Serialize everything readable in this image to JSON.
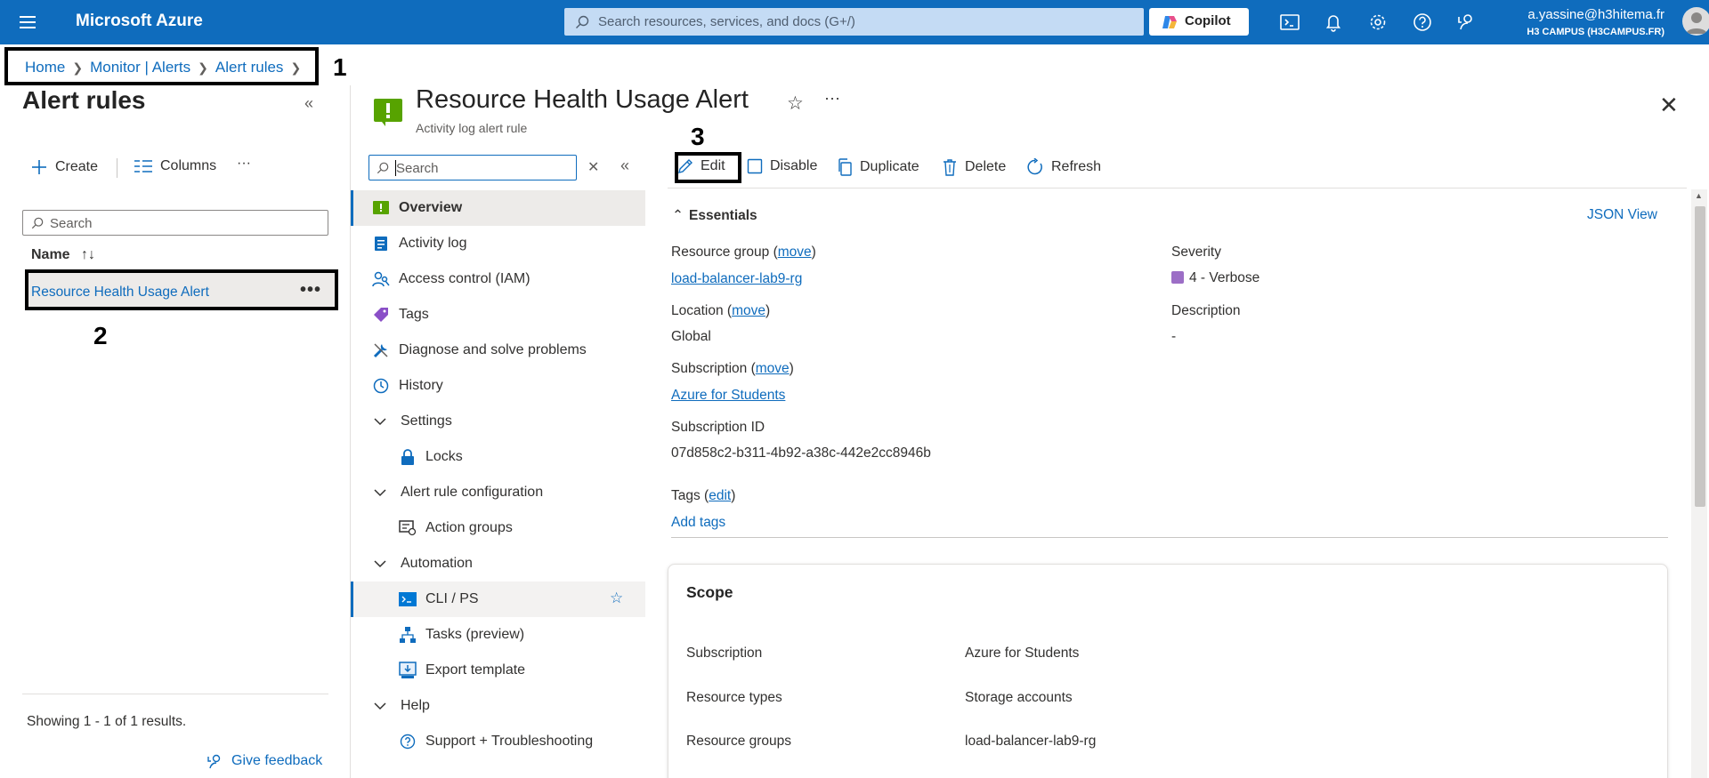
{
  "topbar": {
    "brand": "Microsoft Azure",
    "search_placeholder": "Search resources, services, and docs (G+/)",
    "copilot": "Copilot",
    "account_email": "a.yassine@h3hitema.fr",
    "account_tenant": "H3 CAMPUS (H3CAMPUS.FR)"
  },
  "breadcrumb": [
    "Home",
    "Monitor | Alerts",
    "Alert rules"
  ],
  "annotations": [
    "1",
    "2",
    "3"
  ],
  "left_blade": {
    "title": "Alert rules",
    "create": "Create",
    "columns": "Columns",
    "more": "···",
    "search_placeholder": "Search",
    "column_name": "Name",
    "rows": [
      "Resource Health Usage Alert"
    ],
    "row_more": "•••",
    "showing": "Showing 1 - 1 of 1 results.",
    "feedback": "Give feedback"
  },
  "resource": {
    "title": "Resource Health Usage Alert",
    "subtitle": "Activity log alert rule",
    "more": "···"
  },
  "menu": {
    "search_placeholder": "Search",
    "items": [
      {
        "label": "Overview",
        "icon": "overview-icon"
      },
      {
        "label": "Activity log",
        "icon": "activity-log-icon"
      },
      {
        "label": "Access control (IAM)",
        "icon": "iam-icon"
      },
      {
        "label": "Tags",
        "icon": "tag-icon"
      },
      {
        "label": "Diagnose and solve problems",
        "icon": "wrench-icon"
      },
      {
        "label": "History",
        "icon": "clock-icon"
      },
      {
        "label": "Settings",
        "icon": "chevron-down-icon"
      },
      {
        "label": "Locks",
        "icon": "lock-icon"
      },
      {
        "label": "Alert rule configuration",
        "icon": "chevron-down-icon"
      },
      {
        "label": "Action groups",
        "icon": "action-groups-icon"
      },
      {
        "label": "Automation",
        "icon": "chevron-down-icon"
      },
      {
        "label": "CLI / PS",
        "icon": "terminal-icon"
      },
      {
        "label": "Tasks (preview)",
        "icon": "tasks-icon"
      },
      {
        "label": "Export template",
        "icon": "export-icon"
      },
      {
        "label": "Help",
        "icon": "chevron-down-icon"
      },
      {
        "label": "Support + Troubleshooting",
        "icon": "help-circle-icon"
      }
    ]
  },
  "toolbar": {
    "edit": "Edit",
    "disable": "Disable",
    "duplicate": "Duplicate",
    "delete": "Delete",
    "refresh": "Refresh"
  },
  "essentials": {
    "header": "Essentials",
    "json_view": "JSON View",
    "resource_group_label": "Resource group",
    "resource_group_value": "load-balancer-lab9-rg",
    "move": "move",
    "location_label": "Location",
    "location_value": "Global",
    "subscription_label": "Subscription",
    "subscription_value": "Azure for Students",
    "subscription_id_label": "Subscription ID",
    "subscription_id_value": "07d858c2-b311-4b92-a38c-442e2cc8946b",
    "severity_label": "Severity",
    "severity_value": "4 - Verbose",
    "description_label": "Description",
    "description_value": "-",
    "tags_label": "Tags",
    "tags_edit": "edit",
    "add_tags": "Add tags"
  },
  "scope": {
    "title": "Scope",
    "rows": [
      {
        "label": "Subscription",
        "value": "Azure for Students"
      },
      {
        "label": "Resource types",
        "value": "Storage accounts"
      },
      {
        "label": "Resource groups",
        "value": "load-balancer-lab9-rg"
      }
    ]
  },
  "colors": {
    "azure_blue": "#0f6cbd",
    "severity_verbose": "#9c6ec6",
    "overview_green": "#57a300"
  }
}
